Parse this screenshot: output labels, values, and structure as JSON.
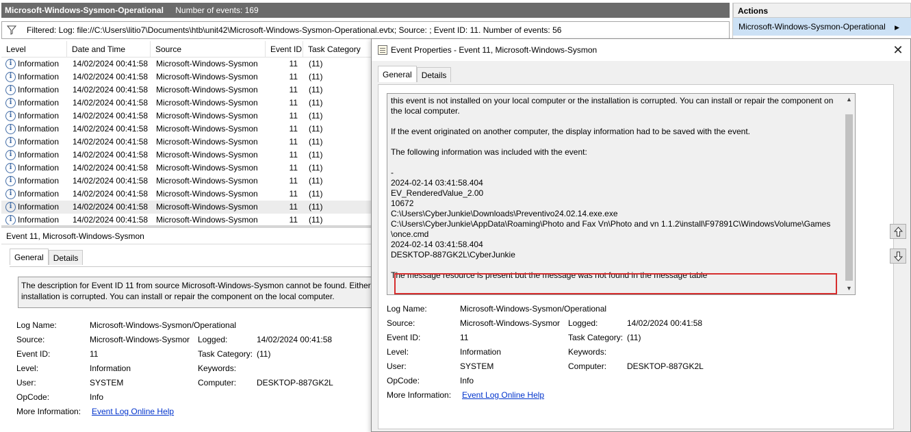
{
  "log_title": "Microsoft-Windows-Sysmon-Operational",
  "events_count": "Number of events: 169",
  "filter_text": "Filtered: Log: file://C:\\Users\\litio7\\Documents\\htb\\unit42\\Microsoft-Windows-Sysmon-Operational.evtx; Source: ; Event ID: 11. Number of events: 56",
  "columns": [
    "Level",
    "Date and Time",
    "Source",
    "Event ID",
    "Task Category"
  ],
  "events": [
    {
      "level": "Information",
      "datetime": "14/02/2024 00:41:58",
      "source": "Microsoft-Windows-Sysmon",
      "id": "11",
      "category": "(11)"
    },
    {
      "level": "Information",
      "datetime": "14/02/2024 00:41:58",
      "source": "Microsoft-Windows-Sysmon",
      "id": "11",
      "category": "(11)"
    },
    {
      "level": "Information",
      "datetime": "14/02/2024 00:41:58",
      "source": "Microsoft-Windows-Sysmon",
      "id": "11",
      "category": "(11)"
    },
    {
      "level": "Information",
      "datetime": "14/02/2024 00:41:58",
      "source": "Microsoft-Windows-Sysmon",
      "id": "11",
      "category": "(11)"
    },
    {
      "level": "Information",
      "datetime": "14/02/2024 00:41:58",
      "source": "Microsoft-Windows-Sysmon",
      "id": "11",
      "category": "(11)"
    },
    {
      "level": "Information",
      "datetime": "14/02/2024 00:41:58",
      "source": "Microsoft-Windows-Sysmon",
      "id": "11",
      "category": "(11)"
    },
    {
      "level": "Information",
      "datetime": "14/02/2024 00:41:58",
      "source": "Microsoft-Windows-Sysmon",
      "id": "11",
      "category": "(11)"
    },
    {
      "level": "Information",
      "datetime": "14/02/2024 00:41:58",
      "source": "Microsoft-Windows-Sysmon",
      "id": "11",
      "category": "(11)"
    },
    {
      "level": "Information",
      "datetime": "14/02/2024 00:41:58",
      "source": "Microsoft-Windows-Sysmon",
      "id": "11",
      "category": "(11)"
    },
    {
      "level": "Information",
      "datetime": "14/02/2024 00:41:58",
      "source": "Microsoft-Windows-Sysmon",
      "id": "11",
      "category": "(11)"
    },
    {
      "level": "Information",
      "datetime": "14/02/2024 00:41:58",
      "source": "Microsoft-Windows-Sysmon",
      "id": "11",
      "category": "(11)"
    },
    {
      "level": "Information",
      "datetime": "14/02/2024 00:41:58",
      "source": "Microsoft-Windows-Sysmon",
      "id": "11",
      "category": "(11)",
      "selected": true
    },
    {
      "level": "Information",
      "datetime": "14/02/2024 00:41:58",
      "source": "Microsoft-Windows-Sysmon",
      "id": "11",
      "category": "(11)"
    }
  ],
  "left_details": {
    "title": "Event 11, Microsoft-Windows-Sysmon",
    "tab_general": "General",
    "tab_details": "Details",
    "description": "The description for Event ID 11 from source Microsoft-Windows-Sysmon cannot be found. Either t\ninstallation is corrupted. You can install or repair the component on the local computer.",
    "log_name_label": "Log Name:",
    "log_name": "Microsoft-Windows-Sysmon/Operational",
    "source_label": "Source:",
    "source": "Microsoft-Windows-Sysmor",
    "logged_label": "Logged:",
    "logged": "14/02/2024 00:41:58",
    "event_id_label": "Event ID:",
    "event_id": "11",
    "task_category_label": "Task Category:",
    "task_category": "(11)",
    "level_label": "Level:",
    "level": "Information",
    "keywords_label": "Keywords:",
    "user_label": "User:",
    "user": "SYSTEM",
    "computer_label": "Computer:",
    "computer": "DESKTOP-887GK2L",
    "opcode_label": "OpCode:",
    "opcode": "Info",
    "more_info_label": "More Information:",
    "more_info_link": "Event Log Online Help"
  },
  "actions": {
    "header": "Actions",
    "item": "Microsoft-Windows-Sysmon-Operational"
  },
  "dialog": {
    "title": "Event Properties - Event 11, Microsoft-Windows-Sysmon",
    "close": "✕",
    "tab_general": "General",
    "tab_details": "Details",
    "description": "this event is not installed on your local computer or the installation is corrupted. You can install or repair the component on\nthe local computer.\n\nIf the event originated on another computer, the display information had to be saved with the event.\n\nThe following information was included with the event:\n\n-\n2024-02-14 03:41:58.404\nEV_RenderedValue_2.00\n10672\nC:\\Users\\CyberJunkie\\Downloads\\Preventivo24.02.14.exe.exe\nC:\\Users\\CyberJunkie\\AppData\\Roaming\\Photo and Fax Vn\\Photo and vn 1.1.2\\install\\F97891C\\WindowsVolume\\Games\n\\once.cmd\n2024-02-14 03:41:58.404\nDESKTOP-887GK2L\\CyberJunkie\n\nThe message resource is present but the message was not found in the message table",
    "log_name_label": "Log Name:",
    "log_name": "Microsoft-Windows-Sysmon/Operational",
    "source_label": "Source:",
    "source": "Microsoft-Windows-Sysmor",
    "logged_label": "Logged:",
    "logged": "14/02/2024 00:41:58",
    "event_id_label": "Event ID:",
    "event_id": "11",
    "task_category_label": "Task Category:",
    "task_category": "(11)",
    "level_label": "Level:",
    "level": "Information",
    "keywords_label": "Keywords:",
    "user_label": "User:",
    "user": "SYSTEM",
    "computer_label": "Computer:",
    "computer": "DESKTOP-887GK2L",
    "opcode_label": "OpCode:",
    "opcode": "Info",
    "more_info_label": "More Information:",
    "more_info_link": "Event Log Online Help"
  },
  "colors": {
    "title_bar": "#6b6b6b",
    "selection": "#cce1f5",
    "highlight_box": "#d62d2d",
    "link": "#0033cc",
    "info_icon": "#3f6aa5"
  },
  "icons": {
    "filter": "filter-funnel-icon",
    "info": "information-icon",
    "up": "arrow-up-icon",
    "down": "arrow-down-icon",
    "close": "close-icon",
    "caret": "chevron-right-icon"
  }
}
